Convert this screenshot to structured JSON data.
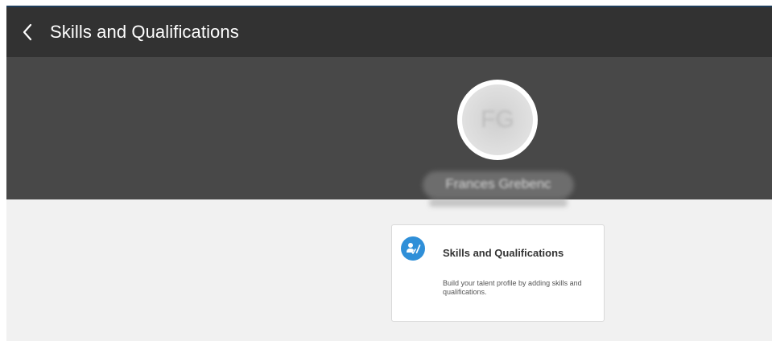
{
  "header": {
    "title": "Skills and Qualifications",
    "back_icon": "chevron-left-icon"
  },
  "profile": {
    "initials": "FG",
    "name": "Frances Grebenc"
  },
  "card": {
    "icon": "skills-edit-icon",
    "title": "Skills and Qualifications",
    "description": "Build your talent profile by adding skills and qualifications."
  },
  "colors": {
    "header_bg": "#323232",
    "banner_bg": "#484848",
    "page_bg": "#f1f1f1",
    "accent": "#2f8fd8"
  }
}
